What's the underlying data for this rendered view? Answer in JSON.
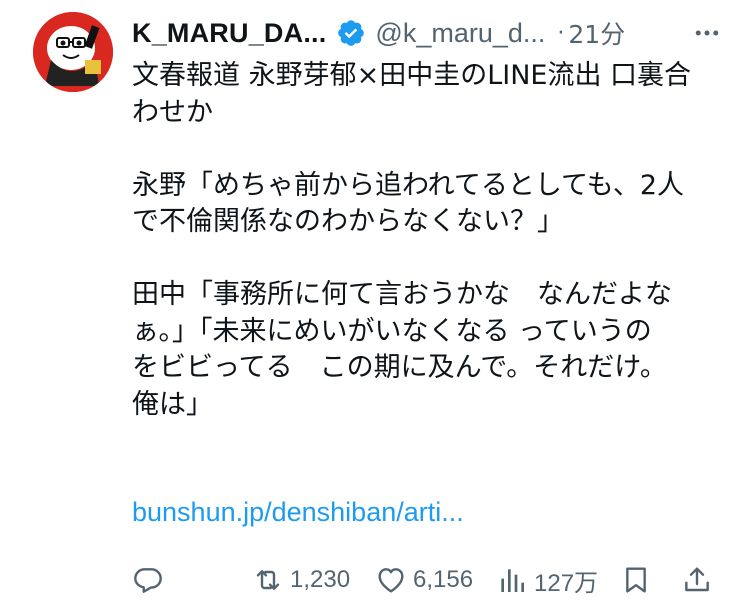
{
  "tweet": {
    "author": {
      "display_name": "K_MARU_DA...",
      "handle": "@k_maru_d...",
      "verified": true,
      "avatar_colors": {
        "bg": "#d8281f",
        "face": "#ffffff"
      }
    },
    "time": "21分",
    "separator": "·",
    "text_lines": [
      "文春報道 永野芽郁×田中圭のLINE流出 口裏合",
      "わせか",
      "",
      "永野「めちゃ前から追われてるとしても、2人",
      "で不倫関係なのわからなくない？」",
      "",
      "田中「事務所に何て言おうかな　なんだよな",
      "ぁ。」「未来にめいがいなくなる っていうの",
      "をビビってる　この期に及んで。それだけ。",
      "俺は」"
    ],
    "link_text": "bunshun.jp/denshiban/arti...",
    "actions": {
      "reply": {
        "icon": "reply-icon",
        "count": ""
      },
      "retweet": {
        "icon": "retweet-icon",
        "count": "1,230"
      },
      "like": {
        "icon": "heart-icon",
        "count": "6,156"
      },
      "views": {
        "icon": "views-icon",
        "count": "127万"
      },
      "bookmark": {
        "icon": "bookmark-icon"
      },
      "share": {
        "icon": "share-icon"
      }
    }
  },
  "colors": {
    "text": "#0f1419",
    "secondary": "#536471",
    "link": "#1d9bf0",
    "verified_badge": "#1d9bf0"
  }
}
